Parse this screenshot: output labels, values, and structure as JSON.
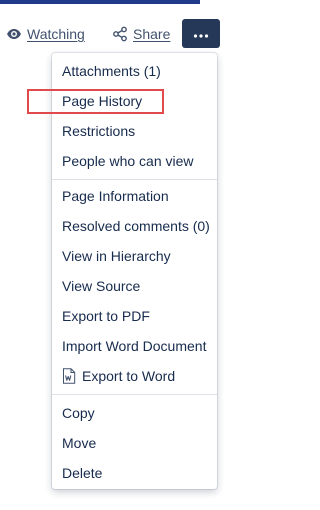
{
  "toolbar": {
    "watching_label": "Watching",
    "share_label": "Share",
    "more_icon": "ellipsis-icon",
    "more_button_color": "#253858"
  },
  "menu": {
    "groups": [
      {
        "items": [
          {
            "label": "Attachments (1)",
            "highlighted": false
          },
          {
            "label": "Page History",
            "highlighted": true
          },
          {
            "label": "Restrictions",
            "highlighted": false
          },
          {
            "label": "People who can view",
            "highlighted": false
          }
        ]
      },
      {
        "items": [
          {
            "label": "Page Information"
          },
          {
            "label": "Resolved comments (0)"
          },
          {
            "label": "View in Hierarchy"
          },
          {
            "label": "View Source"
          },
          {
            "label": "Export to PDF"
          },
          {
            "label": "Import Word Document"
          },
          {
            "label": "Export to Word",
            "icon": "word-document-icon"
          }
        ]
      },
      {
        "items": [
          {
            "label": "Copy"
          },
          {
            "label": "Move"
          },
          {
            "label": "Delete"
          }
        ]
      }
    ]
  },
  "highlight_color": "#e04a4a"
}
